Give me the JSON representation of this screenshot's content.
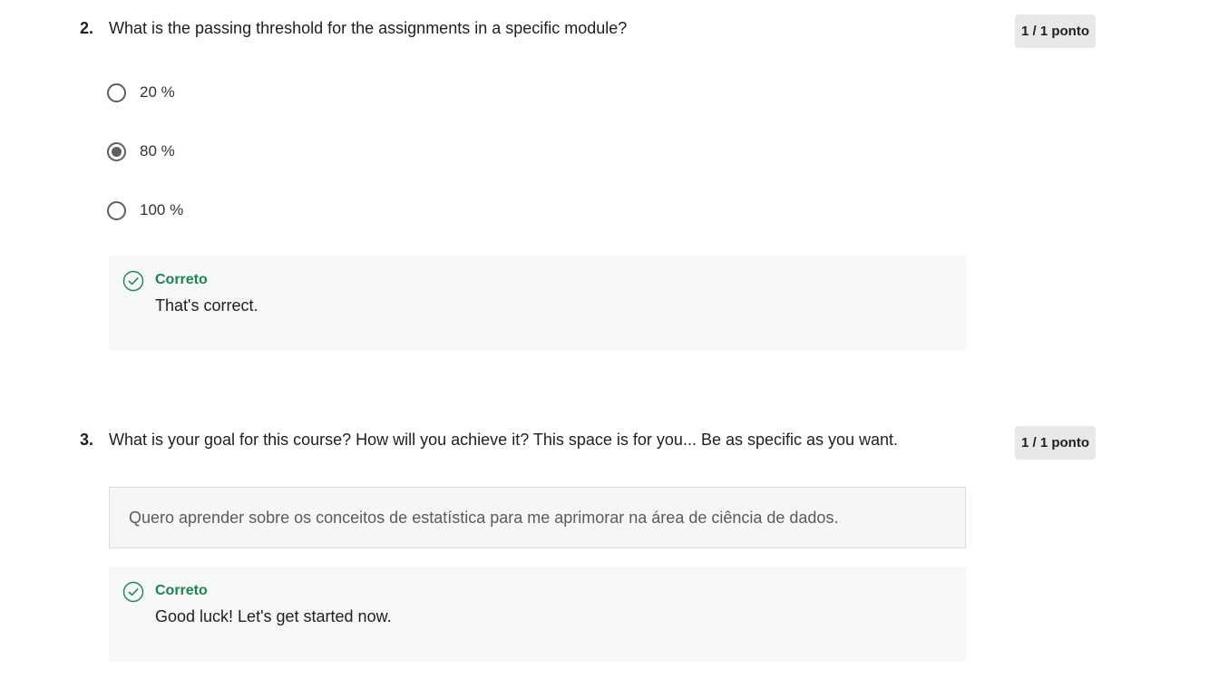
{
  "questions": [
    {
      "number": "2.",
      "text": "What is the passing threshold for the assignments in a specific module?",
      "points": "1 / 1 ponto",
      "options": [
        {
          "label": "20 %",
          "selected": false
        },
        {
          "label": "80 %",
          "selected": true
        },
        {
          "label": "100 %",
          "selected": false
        }
      ],
      "feedback": {
        "status": "Correto",
        "message": "That's correct.",
        "icon": "check-circle-icon"
      }
    },
    {
      "number": "3.",
      "text": "What is your goal for this course? How will you achieve it? This space is for you... Be as specific as you want.",
      "points": "1 / 1 ponto",
      "answer": "Quero aprender sobre os conceitos de estatística para me aprimorar na área de ciência de dados.",
      "feedback": {
        "status": "Correto",
        "message": "Good luck! Let's get started now.",
        "icon": "check-circle-icon"
      }
    }
  ],
  "colors": {
    "correct_green": "#1f8354",
    "feedback_bg": "#f5f8f6",
    "badge_bg": "#e8e8e8",
    "radio_gray": "#5e5e5e"
  }
}
